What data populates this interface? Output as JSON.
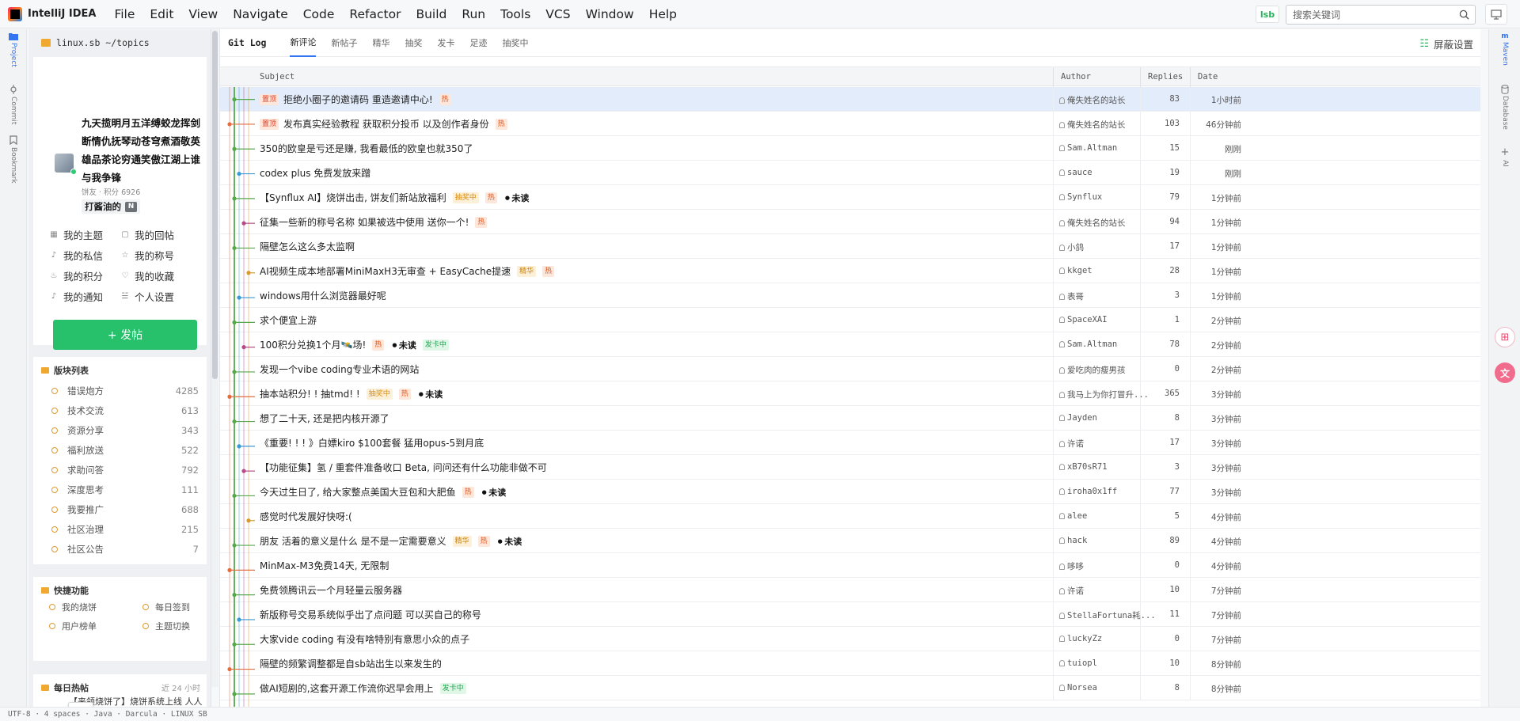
{
  "app": {
    "name": "IntelliJ IDEA",
    "badge": "lsb"
  },
  "menu": [
    "File",
    "Edit",
    "View",
    "Navigate",
    "Code",
    "Refactor",
    "Build",
    "Run",
    "Tools",
    "VCS",
    "Window",
    "Help"
  ],
  "search": {
    "placeholder": "搜索关键词"
  },
  "left_strip": {
    "project": "Project",
    "commit": "Commit",
    "bookmark": "Bookmark"
  },
  "project": {
    "path": "linux.sb ~/topics"
  },
  "user": {
    "motto": "九天揽明月五洋缚蛟龙挥剑断情仇抚琴动苍穹煮酒敬英雄品茶论穷通笑傲江湖上谁与我争锋",
    "meta": "饼友 · 积分 6926",
    "tag": "打酱油的",
    "tag_badge": "N",
    "menu": [
      {
        "icon": "▦",
        "label": "我的主题"
      },
      {
        "icon": "▢",
        "label": "我的回帖"
      },
      {
        "icon": "♪",
        "label": "我的私信"
      },
      {
        "icon": "☆",
        "label": "我的称号"
      },
      {
        "icon": "♨",
        "label": "我的积分"
      },
      {
        "icon": "♡",
        "label": "我的收藏"
      },
      {
        "icon": "♪",
        "label": "我的通知"
      },
      {
        "icon": "☱",
        "label": "个人设置"
      }
    ],
    "post_button": "+ 发帖"
  },
  "boards": {
    "title": "版块列表",
    "items": [
      {
        "name": "错误炮方",
        "count": "4285"
      },
      {
        "name": "技术交流",
        "count": "613"
      },
      {
        "name": "资源分享",
        "count": "343"
      },
      {
        "name": "福利放送",
        "count": "522"
      },
      {
        "name": "求助问答",
        "count": "792"
      },
      {
        "name": "深度思考",
        "count": "111"
      },
      {
        "name": "我要推广",
        "count": "688"
      },
      {
        "name": "社区治理",
        "count": "215"
      },
      {
        "name": "社区公告",
        "count": "7"
      }
    ]
  },
  "quick": {
    "title": "快捷功能",
    "items": [
      "我的烧饼",
      "每日签到",
      "用户榜单",
      "主题切换"
    ]
  },
  "hot": {
    "title": "每日热帖",
    "range": "近 24 小时",
    "first": "【来领烧饼了】烧饼系统上线 人人都有饼吃!"
  },
  "main": {
    "title": "Git Log",
    "tabs": [
      "新评论",
      "新帖子",
      "精华",
      "抽奖",
      "发卡",
      "足迹",
      "抽奖中"
    ],
    "active_tab": 0,
    "block_settings": "屏蔽设置",
    "columns": {
      "subject": "Subject",
      "author": "Author",
      "replies": "Replies",
      "date": "Date"
    }
  },
  "tags": {
    "pin": "置顶",
    "hot": "热",
    "lottery": "抽奖中",
    "elite": "精华",
    "card": "发卡中",
    "unread": "未读"
  },
  "rows": [
    {
      "subject": "拒绝小圈子的邀请码 重造邀请中心!",
      "pin": true,
      "badges": [
        "hot"
      ],
      "unread": false,
      "author": "俺失姓名的站长",
      "replies": "83",
      "date": "1小时前",
      "selected": true
    },
    {
      "subject": "发布真实经验教程 获取积分投币 以及创作者身份",
      "pin": true,
      "badges": [
        "hot"
      ],
      "unread": false,
      "author": "俺失姓名的站长",
      "replies": "103",
      "date": "46分钟前"
    },
    {
      "subject": "350的欧皇是亏还是赚, 我看最低的欧皇也就350了",
      "badges": [],
      "author": "Sam.Altman",
      "replies": "15",
      "date": "刚刚"
    },
    {
      "subject": "codex plus 免费发放来蹭",
      "badges": [],
      "author": "sauce",
      "replies": "19",
      "date": "刚刚"
    },
    {
      "subject": "【Synflux AI】烧饼出击, 饼友们新站放福利",
      "badges": [
        "lottery",
        "hot"
      ],
      "unread": true,
      "author": "Synflux",
      "replies": "79",
      "date": "1分钟前"
    },
    {
      "subject": "征集一些新的称号名称 如果被选中使用 送你一个!",
      "badges": [
        "hot"
      ],
      "author": "俺失姓名的站长",
      "replies": "94",
      "date": "1分钟前"
    },
    {
      "subject": "隔壁怎么这么多太监啊",
      "badges": [],
      "author": "小鸽",
      "replies": "17",
      "date": "1分钟前"
    },
    {
      "subject": "AI视频生成本地部署MiniMaxH3无审查 + EasyCache提速",
      "badges": [
        "elite",
        "hot"
      ],
      "author": "kkget",
      "replies": "28",
      "date": "1分钟前"
    },
    {
      "subject": "windows用什么浏览器最好呢",
      "badges": [],
      "author": "表哥",
      "replies": "3",
      "date": "1分钟前"
    },
    {
      "subject": "求个便宜上游",
      "badges": [],
      "author": "SpaceXAI",
      "replies": "1",
      "date": "2分钟前"
    },
    {
      "subject": "100积分兑换1个月🛰️场!",
      "badges": [
        "hot"
      ],
      "unread": true,
      "after_unread": "card",
      "author": "Sam.Altman",
      "replies": "78",
      "date": "2分钟前"
    },
    {
      "subject": "发现一个vibe coding专业术语的网站",
      "badges": [],
      "author": "爱吃肉的瘦男孩",
      "replies": "0",
      "date": "2分钟前"
    },
    {
      "subject": "抽本站积分! ! 抽tmd! !",
      "badges": [
        "lottery",
        "hot"
      ],
      "unread": true,
      "author": "我马上为你打冒升...",
      "replies": "365",
      "date": "3分钟前"
    },
    {
      "subject": "想了二十天, 还是把内核开源了",
      "badges": [],
      "author": "Jayden",
      "replies": "8",
      "date": "3分钟前"
    },
    {
      "subject": "《重要! ! ! 》白嫖kiro $100套餐 猛用opus-5到月底",
      "badges": [],
      "author": "许诺",
      "replies": "17",
      "date": "3分钟前"
    },
    {
      "subject": "【功能征集】氢 / 重套件准备收口 Beta, 问问还有什么功能非做不可",
      "badges": [],
      "author": "xB70sR71",
      "replies": "3",
      "date": "3分钟前"
    },
    {
      "subject": "今天过生日了, 给大家整点美国大豆包和大肥鱼",
      "badges": [
        "hot"
      ],
      "unread": true,
      "author": "iroha0x1ff",
      "replies": "77",
      "date": "3分钟前"
    },
    {
      "subject": "感觉时代发展好快呀:(",
      "badges": [],
      "author": "alee",
      "replies": "5",
      "date": "4分钟前"
    },
    {
      "subject": "朋友 活着的意义是什么 是不是一定需要意义",
      "badges": [
        "elite",
        "hot"
      ],
      "unread": true,
      "author": "hack",
      "replies": "89",
      "date": "4分钟前"
    },
    {
      "subject": "MinMax-M3免费14天, 无限制",
      "badges": [],
      "author": "哆哆",
      "replies": "0",
      "date": "4分钟前"
    },
    {
      "subject": "免费领腾讯云一个月轻量云服务器",
      "badges": [],
      "author": "许诺",
      "replies": "10",
      "date": "7分钟前"
    },
    {
      "subject": "新版称号交易系统似乎出了点问题 可以买自己的称号",
      "badges": [],
      "author": "StellaFortuna耗...",
      "replies": "11",
      "date": "7分钟前"
    },
    {
      "subject": "大家vide coding 有没有啥特别有意思小众的点子",
      "badges": [],
      "author": "luckyZz",
      "replies": "0",
      "date": "7分钟前"
    },
    {
      "subject": "隔壁的频繁调整都是自sb站出生以来发生的",
      "badges": [],
      "author": "tuiopl",
      "replies": "10",
      "date": "8分钟前"
    },
    {
      "subject": "做AI短剧的,这套开源工作流你迟早会用上",
      "badges": [
        "card"
      ],
      "author": "Norsea",
      "replies": "8",
      "date": "8分钟前"
    }
  ],
  "right_strip": {
    "maven": "Maven",
    "database": "Database",
    "ai": "AI"
  },
  "status": "UTF-8 · 4 spaces · Java · Darcula · LINUX SB",
  "colors": {
    "accent": "#3574f0",
    "brand_green": "#27c06b",
    "hot": "#e0571e"
  }
}
